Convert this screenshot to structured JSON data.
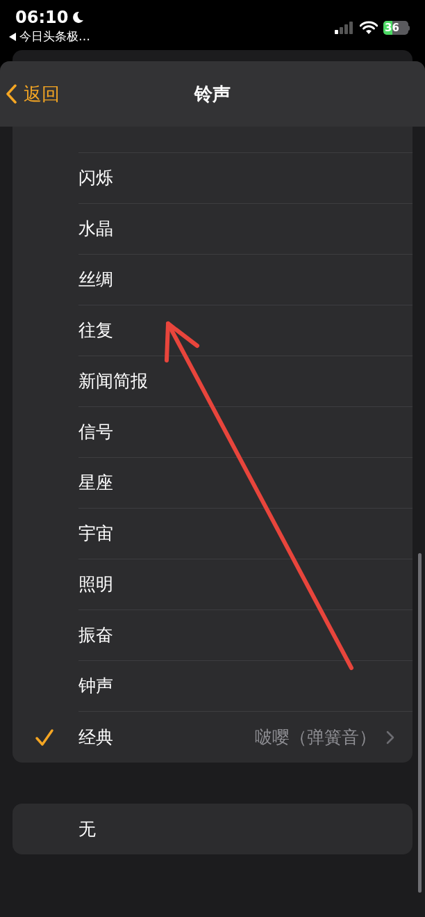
{
  "status_bar": {
    "time": "06:10",
    "back_app": "今日头条极…",
    "battery": "36"
  },
  "nav": {
    "back": "返回",
    "title": "铃声"
  },
  "ringtones": [
    {
      "label": "闪烁",
      "selected": false
    },
    {
      "label": "水晶",
      "selected": false
    },
    {
      "label": "丝绸",
      "selected": false
    },
    {
      "label": "往复",
      "selected": false
    },
    {
      "label": "新闻简报",
      "selected": false
    },
    {
      "label": "信号",
      "selected": false
    },
    {
      "label": "星座",
      "selected": false
    },
    {
      "label": "宇宙",
      "selected": false
    },
    {
      "label": "照明",
      "selected": false
    },
    {
      "label": "振奋",
      "selected": false
    },
    {
      "label": "钟声",
      "selected": false
    },
    {
      "label": "经典",
      "selected": true,
      "detail": "啵嘤（弹簧音）"
    }
  ],
  "none_option": {
    "label": "无",
    "selected": false
  }
}
